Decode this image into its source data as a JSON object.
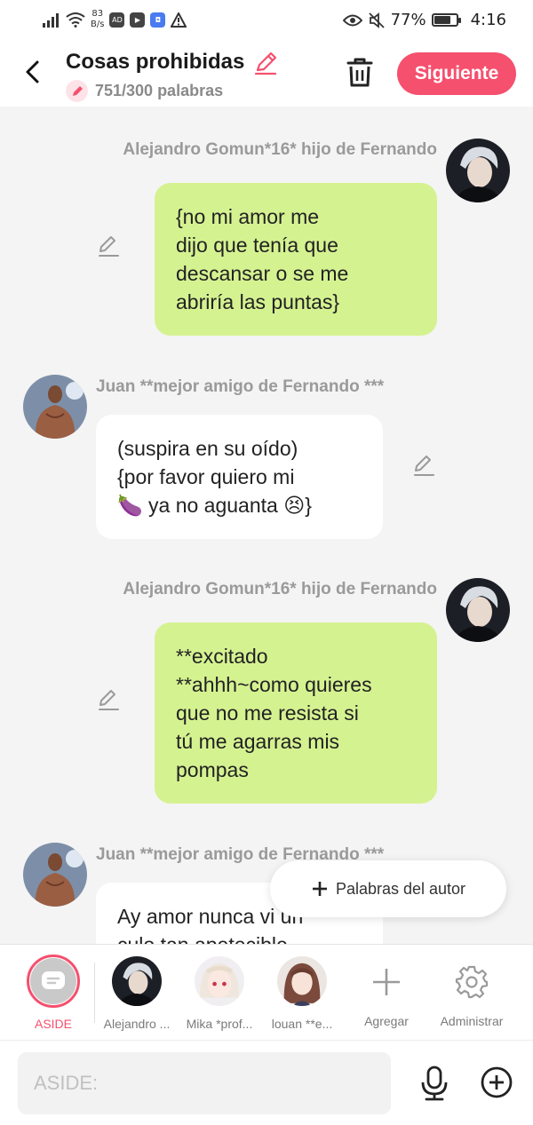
{
  "status_bar": {
    "net_speed": "83",
    "net_unit": "B/s",
    "ad_badge": "AD",
    "battery_percent_label": "77%",
    "battery_level": 0.77,
    "time": "4:16"
  },
  "header": {
    "title": "Cosas prohibidas",
    "word_count": "751/300 palabras",
    "next_label": "Siguiente"
  },
  "colors": {
    "accent": "#f5506e",
    "my_bubble": "#d5f291",
    "other_bubble": "#ffffff",
    "background": "#f4f4f4"
  },
  "messages": [
    {
      "side": "right",
      "author": "Alejandro Gomun*16* hijo de Fernando",
      "text_lines": [
        "{no mi amor me",
        "dijo que tenía que",
        "descansar o se me",
        "abriría las puntas}"
      ]
    },
    {
      "side": "left",
      "author": "Juan **mejor amigo de Fernando ***",
      "text_lines": [
        "(suspira en su oído)",
        "{por favor quiero mi",
        "🍆 ya no aguanta 😣}"
      ]
    },
    {
      "side": "right",
      "author": "Alejandro Gomun*16* hijo de Fernando",
      "text_lines": [
        "**excitado",
        "**ahhh~como quieres",
        "que no me resista si",
        "tú me agarras mis",
        "pompas"
      ]
    },
    {
      "side": "left",
      "author": "Juan **mejor amigo de Fernando ***",
      "text_lines": [
        "Ay amor nunca vi un",
        "culo tan apetecible"
      ]
    }
  ],
  "author_words_label": "Palabras del autor",
  "characters": [
    {
      "label": "ASIDE",
      "selected": true
    },
    {
      "label": "Alejandro ..."
    },
    {
      "label": "Mika *prof..."
    },
    {
      "label": "louan **e..."
    },
    {
      "label": "Agregar",
      "icon": "plus-icon"
    },
    {
      "label": "Administrar",
      "icon": "gear-icon"
    }
  ],
  "composer": {
    "placeholder": "ASIDE:",
    "value": ""
  }
}
